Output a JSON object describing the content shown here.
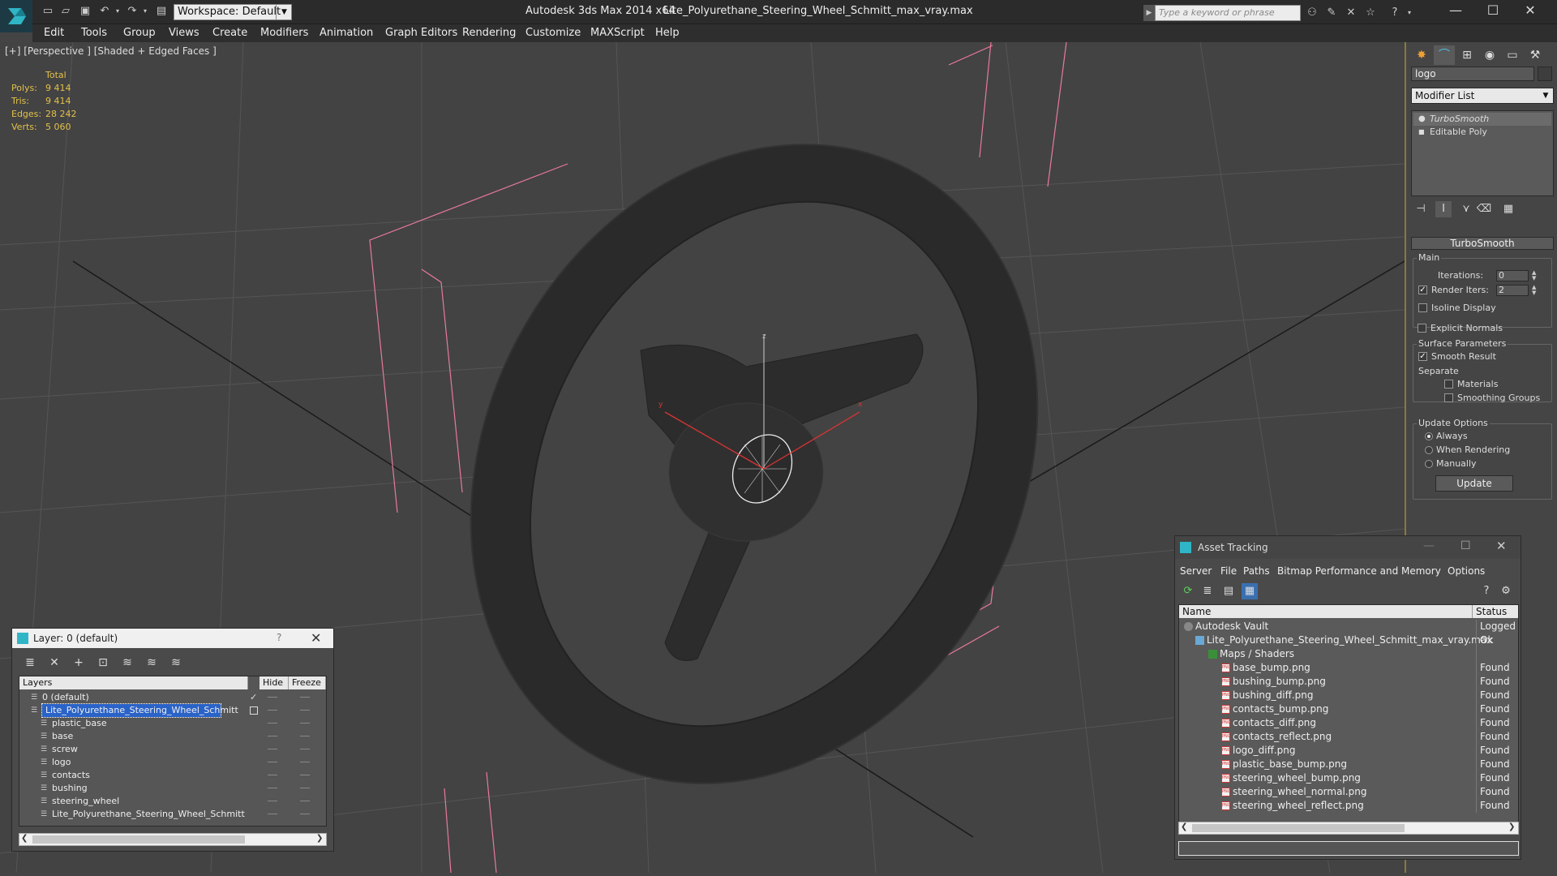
{
  "window": {
    "app_title": "Autodesk 3ds Max  2014 x64",
    "file_title": "Lite_Polyurethane_Steering_Wheel_Schmitt_max_vray.max",
    "workspace": "Workspace: Default",
    "search_placeholder": "Type a keyword or phrase"
  },
  "menu": [
    "Edit",
    "Tools",
    "Group",
    "Views",
    "Create",
    "Modifiers",
    "Animation",
    "Graph Editors",
    "Rendering",
    "Customize",
    "MAXScript",
    "Help"
  ],
  "viewport": {
    "label": "[+] [Perspective ] [Shaded + Edged Faces ]",
    "stats_header": "Total",
    "stats": [
      {
        "label": "Polys:",
        "value": "9 414"
      },
      {
        "label": "Tris:",
        "value": "9 414"
      },
      {
        "label": "Edges:",
        "value": "28 242"
      },
      {
        "label": "Verts:",
        "value": "5 060"
      }
    ],
    "axis_z": "z",
    "axis_x": "x",
    "axis_y": "y"
  },
  "command_panel": {
    "object_name": "logo",
    "modifier_list": "Modifier List",
    "stack": [
      "TurboSmooth",
      "Editable Poly"
    ],
    "rollout": "TurboSmooth",
    "main_group": "Main",
    "iterations_label": "Iterations:",
    "iterations_value": "0",
    "render_iters_label": "Render Iters:",
    "render_iters_value": "2",
    "isoline": "Isoline Display",
    "explicit_normals": "Explicit Normals",
    "surface_group": "Surface Parameters",
    "smooth_result": "Smooth Result",
    "separate": "Separate",
    "materials": "Materials",
    "smoothing_groups": "Smoothing Groups",
    "update_group": "Update Options",
    "always": "Always",
    "when_rendering": "When Rendering",
    "manually": "Manually",
    "update_button": "Update"
  },
  "layers": {
    "title": "Layer: 0 (default)",
    "help": "?",
    "col_layers": "Layers",
    "col_hide": "Hide",
    "col_freeze": "Freeze",
    "items": [
      {
        "name": "0 (default)",
        "level": 1
      },
      {
        "name": "Lite_Polyurethane_Steering_Wheel_Schmitt",
        "level": 1
      },
      {
        "name": "plastic_base",
        "level": 2
      },
      {
        "name": "base",
        "level": 2
      },
      {
        "name": "screw",
        "level": 2
      },
      {
        "name": "logo",
        "level": 2
      },
      {
        "name": "contacts",
        "level": 2
      },
      {
        "name": "bushing",
        "level": 2
      },
      {
        "name": "steering_wheel",
        "level": 2
      },
      {
        "name": "Lite_Polyurethane_Steering_Wheel_Schmitt",
        "level": 2
      }
    ]
  },
  "asset_tracking": {
    "title": "Asset Tracking",
    "menu": [
      "Server",
      "File",
      "Paths",
      "Bitmap Performance and Memory",
      "Options"
    ],
    "col_name": "Name",
    "col_status": "Status",
    "rows": [
      {
        "name": "Autodesk Vault",
        "status": "Logged O",
        "level": 0
      },
      {
        "name": "Lite_Polyurethane_Steering_Wheel_Schmitt_max_vray.max",
        "status": "Ok",
        "level": 1
      },
      {
        "name": "Maps / Shaders",
        "status": "",
        "level": 2
      },
      {
        "name": "base_bump.png",
        "status": "Found",
        "level": 3
      },
      {
        "name": "bushing_bump.png",
        "status": "Found",
        "level": 3
      },
      {
        "name": "bushing_diff.png",
        "status": "Found",
        "level": 3
      },
      {
        "name": "contacts_bump.png",
        "status": "Found",
        "level": 3
      },
      {
        "name": "contacts_diff.png",
        "status": "Found",
        "level": 3
      },
      {
        "name": "contacts_reflect.png",
        "status": "Found",
        "level": 3
      },
      {
        "name": "logo_diff.png",
        "status": "Found",
        "level": 3
      },
      {
        "name": "plastic_base_bump.png",
        "status": "Found",
        "level": 3
      },
      {
        "name": "steering_wheel_bump.png",
        "status": "Found",
        "level": 3
      },
      {
        "name": "steering_wheel_normal.png",
        "status": "Found",
        "level": 3
      },
      {
        "name": "steering_wheel_reflect.png",
        "status": "Found",
        "level": 3
      }
    ]
  }
}
